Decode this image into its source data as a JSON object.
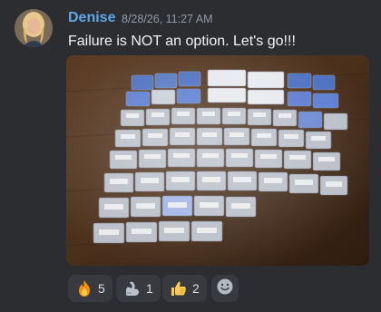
{
  "message": {
    "author": "Denise",
    "timestamp": "8/28/26, 11:27 AM",
    "text": "Failure is NOT an option. Let's go!!!"
  },
  "colors": {
    "background": "#2b2d31",
    "author": "#5fa7e6",
    "timestamp": "#949ba4",
    "reaction_bg": "#383a40"
  },
  "attachment": {
    "description_icon": "photo-of-vial-boxes"
  },
  "reactions": [
    {
      "icon": "fire-icon",
      "count": "5"
    },
    {
      "icon": "flexed-biceps-icon",
      "count": "1"
    },
    {
      "icon": "thumbs-up-icon",
      "count": "2"
    }
  ],
  "add_reaction_icon": "smiley-add-icon"
}
